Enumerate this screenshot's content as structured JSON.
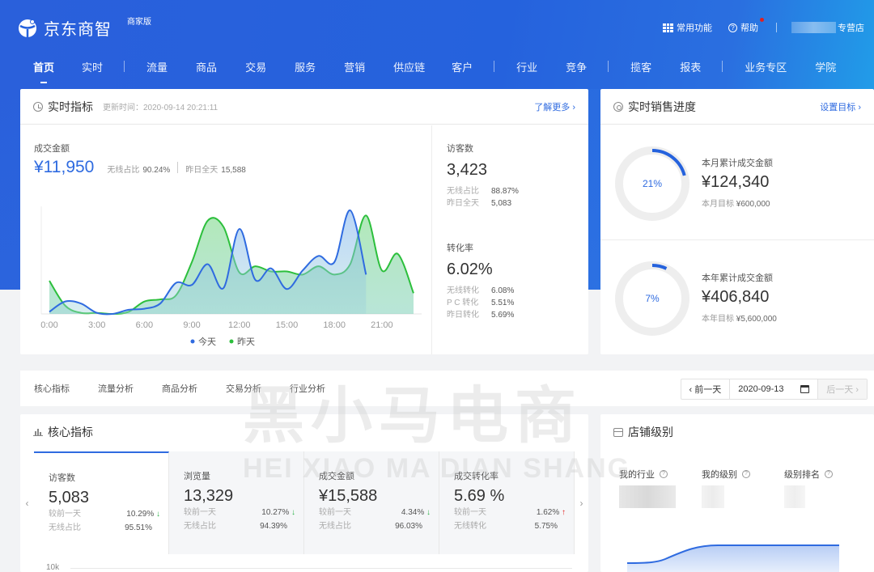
{
  "app": {
    "brand": "京东商智",
    "edition_badge": "商家版",
    "brand_color": "#2562dd",
    "accent_color": "#2f6be0"
  },
  "top_right": {
    "common_functions": "常用功能",
    "help": "帮助",
    "store_suffix": "专营店"
  },
  "nav": {
    "items": [
      "首页",
      "实时",
      "流量",
      "商品",
      "交易",
      "服务",
      "营销",
      "供应链",
      "客户",
      "行业",
      "竞争",
      "揽客",
      "报表",
      "业务专区",
      "学院"
    ],
    "active": "首页"
  },
  "realtime": {
    "title": "实时指标",
    "update_time": "更新时间：2020-09-14 20:21:11",
    "more_link": "了解更多 ›",
    "gmv": {
      "label": "成交金额",
      "value": "¥11,950",
      "wireless_label": "无线占比",
      "wireless_value": "90.24%",
      "yesterday_label": "昨日全天",
      "yesterday_value": "15,588"
    },
    "visitors": {
      "label": "访客数",
      "value": "3,423",
      "rows": [
        {
          "k": "无线占比",
          "v": "88.87%"
        },
        {
          "k": "昨日全天",
          "v": "5,083"
        }
      ]
    },
    "conversion": {
      "label": "转化率",
      "value": "6.02%",
      "rows": [
        {
          "k": "无线转化",
          "v": "6.08%"
        },
        {
          "k": "P C 转化",
          "v": "5.51%"
        },
        {
          "k": "昨日转化",
          "v": "5.69%"
        }
      ]
    }
  },
  "chart_data": {
    "type": "area",
    "title": "",
    "xlabel": "",
    "ylabel": "",
    "x": [
      0,
      1,
      2,
      3,
      4,
      5,
      6,
      7,
      8,
      9,
      10,
      11,
      12,
      13,
      14,
      15,
      16,
      17,
      18,
      19,
      20,
      21,
      22,
      23
    ],
    "x_tick_labels": [
      "0:00",
      "3:00",
      "6:00",
      "9:00",
      "12:00",
      "15:00",
      "18:00",
      "21:00"
    ],
    "x_tick_values": [
      0,
      3,
      6,
      9,
      12,
      15,
      18,
      21
    ],
    "ylim": [
      0,
      100
    ],
    "grid": false,
    "legend": "bottom-center",
    "series": [
      {
        "name": "今天",
        "color": "#2f6be0",
        "values": [
          2,
          12,
          10,
          1,
          0,
          4,
          5,
          10,
          30,
          28,
          48,
          25,
          82,
          33,
          44,
          24,
          42,
          56,
          50,
          100,
          38
        ]
      },
      {
        "name": "昨天",
        "color": "#2cbf3c",
        "values": [
          32,
          8,
          1,
          1,
          0,
          2,
          12,
          14,
          18,
          50,
          90,
          84,
          40,
          46,
          41,
          41,
          38,
          46,
          38,
          48,
          95,
          42,
          58,
          20
        ]
      }
    ]
  },
  "sales_progress": {
    "title": "实时销售进度",
    "set_target_link": "设置目标 ›",
    "month": {
      "label": "本月累计成交金额",
      "value": "¥124,340",
      "target_label": "本月目标",
      "target_value": "¥600,000",
      "percent_text": "21%",
      "percent": 21
    },
    "year": {
      "label": "本年累计成交金额",
      "value": "¥406,840",
      "target_label": "本年目标",
      "target_value": "¥5,600,000",
      "percent_text": "7%",
      "percent": 7
    }
  },
  "analysis_tabs": {
    "items": [
      "核心指标",
      "流量分析",
      "商品分析",
      "交易分析",
      "行业分析"
    ]
  },
  "date_picker": {
    "prev": "‹ 前一天",
    "date": "2020-09-13",
    "next": "后一天 ›"
  },
  "core_metrics": {
    "title": "核心指标",
    "cards": [
      {
        "label": "访客数",
        "value": "5,083",
        "r1k": "较前一天",
        "r1v": "10.29%",
        "r1dir": "down",
        "r2k": "无线占比",
        "r2v": "95.51%"
      },
      {
        "label": "浏览量",
        "value": "13,329",
        "r1k": "较前一天",
        "r1v": "10.27%",
        "r1dir": "down",
        "r2k": "无线占比",
        "r2v": "94.39%"
      },
      {
        "label": "成交金额",
        "value": "¥15,588",
        "r1k": "较前一天",
        "r1v": "4.34%",
        "r1dir": "down",
        "r2k": "无线占比",
        "r2v": "96.03%"
      },
      {
        "label": "成交转化率",
        "value": "5.69 %",
        "r1k": "较前一天",
        "r1v": "1.62%",
        "r1dir": "up",
        "r2k": "无线转化",
        "r2v": "5.75%"
      }
    ],
    "axis_top_label": "10k",
    "arrow_down": "↓",
    "arrow_up": "↑",
    "prev_arrow": "‹",
    "next_arrow": "›"
  },
  "store_level": {
    "title": "店铺级别",
    "columns": [
      "我的行业",
      "我的级别",
      "级别排名"
    ],
    "help_glyph": "?"
  },
  "watermark": {
    "cn": "黑小马电商",
    "en": "HEI XIAO MA DIAN SHANG"
  }
}
